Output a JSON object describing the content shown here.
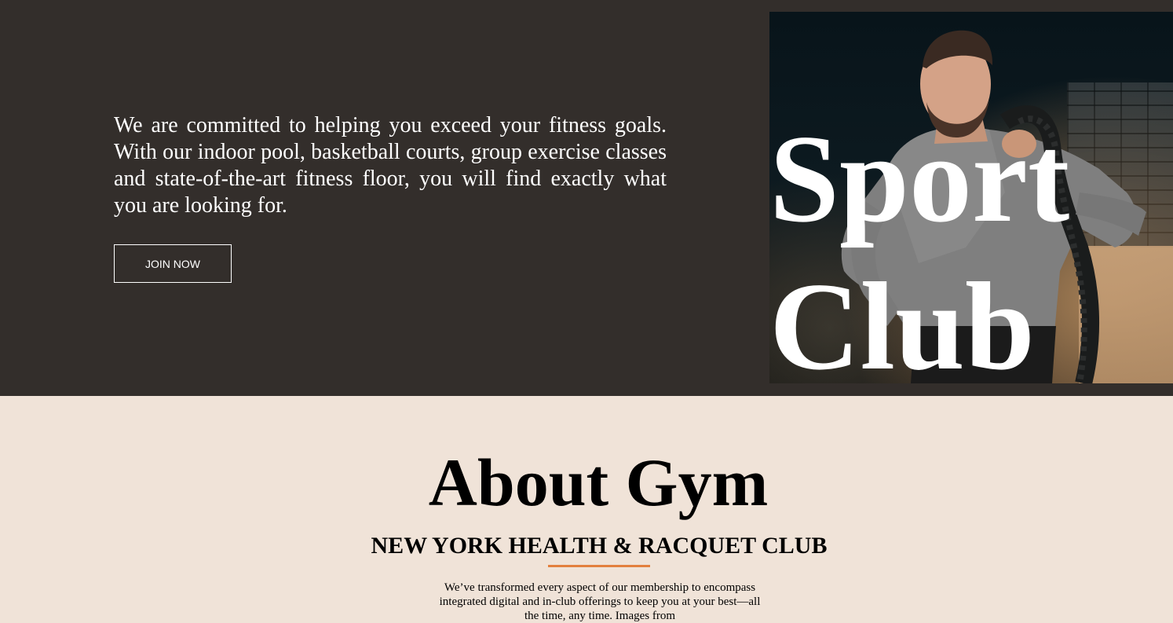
{
  "hero": {
    "text": "We are committed to helping you exceed your fitness goals. With our indoor pool, basketball courts, group exercise classes and state-of-the-art fitness floor, you will find exactly what you are looking for.",
    "join_button_label": "JOIN NOW",
    "photo_title_line1": "Sport",
    "photo_title_line2": "Club"
  },
  "about": {
    "title": "About Gym",
    "subtitle": "NEW YORK HEALTH & RACQUET CLUB",
    "body": "We’ve transformed every aspect of our membership to encompass integrated digital and in-club offerings to keep you at your best—all the time, any time. Images from"
  },
  "colors": {
    "hero_background": "#332e2b",
    "about_background": "#f0e3d8",
    "accent_rule": "#e3803e",
    "text_light": "#ffffff",
    "text_dark": "#000000"
  }
}
